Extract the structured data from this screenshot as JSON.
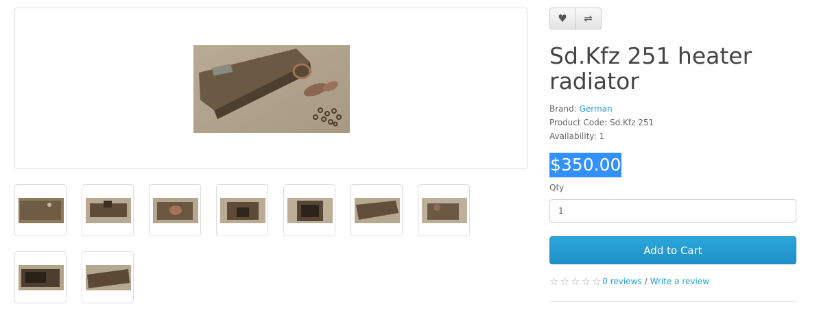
{
  "product": {
    "title": "Sd.Kfz 251 heater radiator",
    "brand_label": "Brand:",
    "brand": "German",
    "code_label": "Product Code:",
    "code": "Sd.Kfz 251",
    "availability_label": "Availability:",
    "availability": "1",
    "price": "$350.00"
  },
  "qty": {
    "label": "Qty",
    "value": "1"
  },
  "cart": {
    "label": "Add to Cart"
  },
  "reviews": {
    "count_label": "0 reviews",
    "separator": "/",
    "write_label": "Write a review",
    "stars": 5
  },
  "icons": {
    "wishlist": "heart-icon",
    "compare": "compare-icon"
  },
  "colors": {
    "link": "#23a1d1",
    "cart_button": "#229ac8",
    "price_highlight": "#3390ff"
  },
  "thumbnails_count": 9
}
